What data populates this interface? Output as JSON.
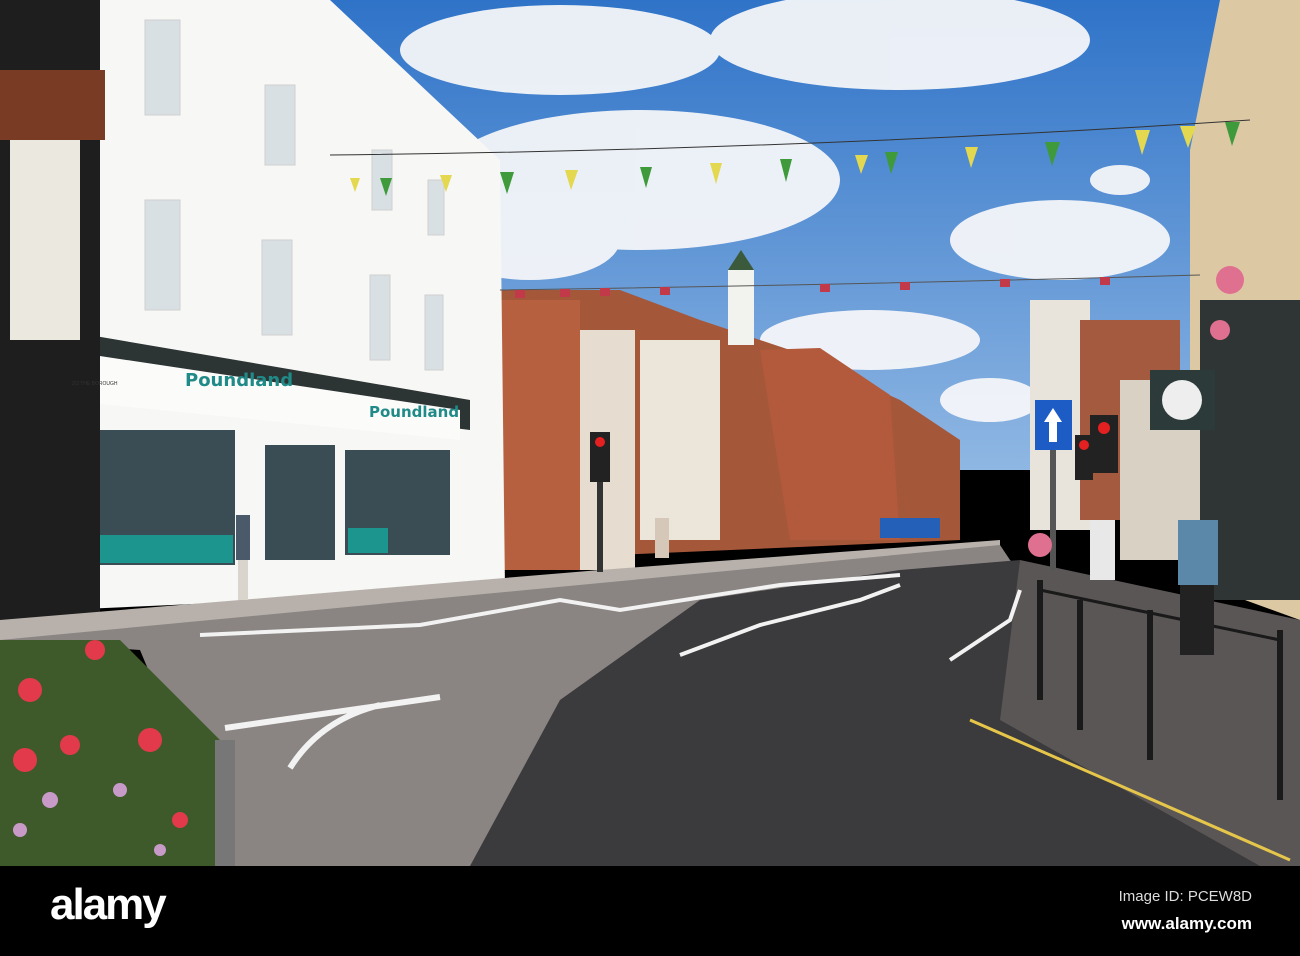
{
  "photo": {
    "shop_sign_primary": "Poundland",
    "shop_sign_secondary": "Poundland",
    "shop_address": "2/3 THE BOROUGH"
  },
  "watermark": {
    "logo": "alamy",
    "image_id": "Image ID: PCEW8D",
    "url": "www.alamy.com"
  },
  "colors": {
    "sky": "#3d7fcf",
    "brand_teal": "#1f8a87",
    "road": "#6e6a68"
  }
}
